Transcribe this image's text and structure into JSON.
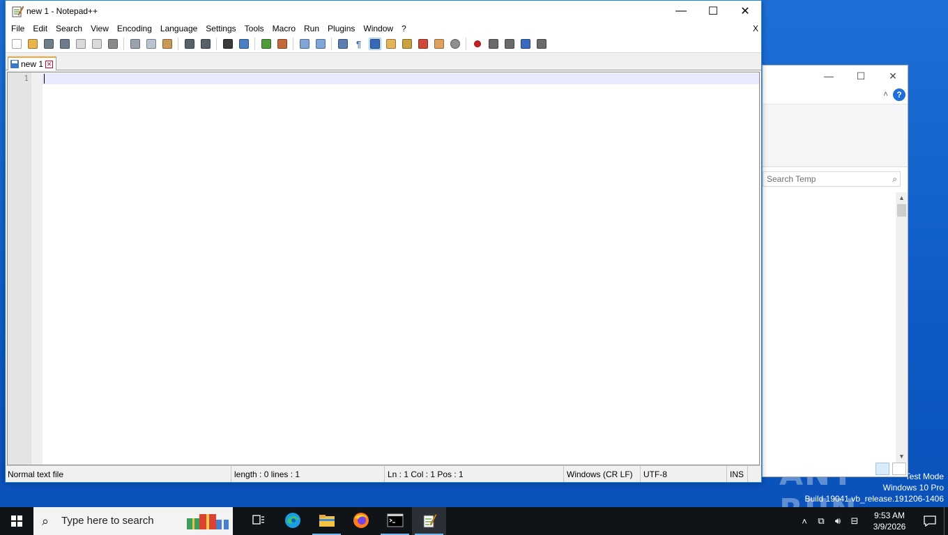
{
  "desktop": {
    "watermark": [
      "Test Mode",
      "Windows 10 Pro",
      "Build 19041.vb_release.191206-1406"
    ],
    "brand": "ANY RUN"
  },
  "explorer": {
    "caption": {
      "minimize": "—",
      "maximize": "☐",
      "close": "✕"
    },
    "collapse": "˄",
    "help": "?",
    "search_placeholder": "Search Temp",
    "scroll_up": "▲",
    "scroll_down": "▼"
  },
  "npp": {
    "title": "new 1 - Notepad++",
    "caption": {
      "minimize": "—",
      "maximize": "☐",
      "close": "✕"
    },
    "menu": [
      "File",
      "Edit",
      "Search",
      "View",
      "Encoding",
      "Language",
      "Settings",
      "Tools",
      "Macro",
      "Run",
      "Plugins",
      "Window",
      "?"
    ],
    "menu_close": "X",
    "toolbar": [
      {
        "name": "new-file-icon",
        "color": "#ffffff"
      },
      {
        "name": "open-file-icon",
        "color": "#e8b64a"
      },
      {
        "name": "save-icon",
        "color": "#6f7c8c"
      },
      {
        "name": "save-all-icon",
        "color": "#6f7c8c"
      },
      {
        "name": "close-icon",
        "color": "#d9d9d9"
      },
      {
        "name": "close-all-icon",
        "color": "#d9d9d9"
      },
      {
        "name": "print-icon",
        "color": "#8a8a8a"
      },
      {
        "sep": true
      },
      {
        "name": "cut-icon",
        "color": "#9aa3ad"
      },
      {
        "name": "copy-icon",
        "color": "#b8c4d0"
      },
      {
        "name": "paste-icon",
        "color": "#c99a55"
      },
      {
        "sep": true
      },
      {
        "name": "undo-icon",
        "color": "#58606a"
      },
      {
        "name": "redo-icon",
        "color": "#58606a"
      },
      {
        "sep": true
      },
      {
        "name": "find-icon",
        "color": "#3a3a3a"
      },
      {
        "name": "replace-icon",
        "color": "#4a80c0"
      },
      {
        "sep": true
      },
      {
        "name": "zoom-in-icon",
        "color": "#4f9a3c"
      },
      {
        "name": "zoom-out-icon",
        "color": "#c46a3a"
      },
      {
        "sep": true
      },
      {
        "name": "sync-vertical-icon",
        "color": "#7fa6d6"
      },
      {
        "name": "sync-horizontal-icon",
        "color": "#7fa6d6"
      },
      {
        "sep": true
      },
      {
        "name": "word-wrap-icon",
        "color": "#5a7fb0"
      },
      {
        "name": "show-all-chars-icon",
        "color": "#4a6ea8",
        "glyph": "¶"
      },
      {
        "name": "indent-guide-icon",
        "color": "#3868b8",
        "active": true
      },
      {
        "name": "user-language-icon",
        "color": "#e3b45a"
      },
      {
        "name": "doc-map-icon",
        "color": "#c9a040"
      },
      {
        "name": "function-list-icon",
        "color": "#d04a3a"
      },
      {
        "name": "folder-as-workspace-icon",
        "color": "#e0a060"
      },
      {
        "name": "monitoring-icon",
        "color": "#8f8f8f"
      },
      {
        "sep": true
      },
      {
        "name": "record-macro-icon",
        "color": "#cc1f1f"
      },
      {
        "name": "stop-recording-icon",
        "color": "#6a6a6a"
      },
      {
        "name": "playback-macro-icon",
        "color": "#6a6a6a"
      },
      {
        "name": "run-macro-multiple-icon",
        "color": "#3a6ac0"
      },
      {
        "name": "save-macro-icon",
        "color": "#6a6a6a"
      }
    ],
    "tab": {
      "label": "new 1",
      "close": "✕"
    },
    "gutter": [
      "1"
    ],
    "status": {
      "type": "Normal text file",
      "length_lines": "length : 0    lines : 1",
      "position": "Ln : 1    Col : 1    Pos : 1",
      "eol": "Windows (CR LF)",
      "encoding": "UTF-8",
      "mode": "INS"
    }
  },
  "taskbar": {
    "search_placeholder": "Type here to search",
    "apps": [
      {
        "name": "task-view-icon",
        "running": false
      },
      {
        "name": "edge-icon",
        "running": false
      },
      {
        "name": "file-explorer-icon",
        "running": true
      },
      {
        "name": "firefox-icon",
        "running": false
      },
      {
        "name": "cmd-icon",
        "running": true
      },
      {
        "name": "notepad-plus-plus-icon",
        "running": true,
        "focused": true
      }
    ],
    "time": "9:53 AM",
    "date": "3/9/2026"
  }
}
